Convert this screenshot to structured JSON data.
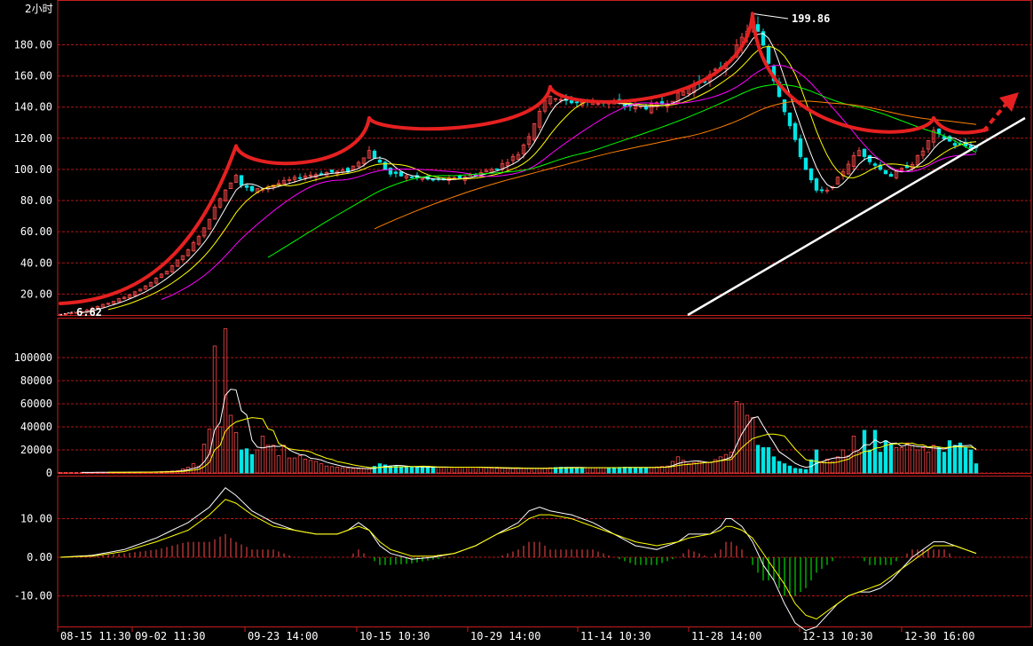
{
  "chart_data": {
    "type": "candlestick",
    "period_label": "2小时",
    "price_panel": {
      "ylim": [
        0,
        210
      ],
      "yticks": [
        "20.00",
        "40.00",
        "60.00",
        "80.00",
        "100.00",
        "120.00",
        "140.00",
        "160.00",
        "180.00"
      ],
      "high_label": "199.86",
      "low_label": "6.62",
      "ma_colors": [
        "#ffffff",
        "#ffff00",
        "#ff00ff",
        "#00ff00",
        "#ff8000"
      ],
      "anchors": [
        [
          0,
          7
        ],
        [
          4,
          9
        ],
        [
          8,
          13
        ],
        [
          12,
          18
        ],
        [
          16,
          25
        ],
        [
          20,
          35
        ],
        [
          24,
          48
        ],
        [
          27,
          62
        ],
        [
          30,
          82
        ],
        [
          33,
          97
        ],
        [
          34,
          90
        ],
        [
          36,
          86
        ],
        [
          38,
          88
        ],
        [
          42,
          92
        ],
        [
          46,
          96
        ],
        [
          50,
          98
        ],
        [
          54,
          99
        ],
        [
          56,
          105
        ],
        [
          58,
          112
        ],
        [
          60,
          104
        ],
        [
          62,
          97
        ],
        [
          66,
          95
        ],
        [
          70,
          93
        ],
        [
          74,
          94
        ],
        [
          78,
          97
        ],
        [
          82,
          101
        ],
        [
          86,
          110
        ],
        [
          88,
          122
        ],
        [
          90,
          138
        ],
        [
          92,
          148
        ],
        [
          94,
          144
        ],
        [
          98,
          143
        ],
        [
          102,
          143
        ],
        [
          106,
          141
        ],
        [
          110,
          140
        ],
        [
          114,
          143
        ],
        [
          118,
          152
        ],
        [
          122,
          160
        ],
        [
          126,
          172
        ],
        [
          128,
          184
        ],
        [
          130,
          195
        ],
        [
          132,
          180
        ],
        [
          134,
          158
        ],
        [
          136,
          138
        ],
        [
          138,
          118
        ],
        [
          140,
          100
        ],
        [
          142,
          86
        ],
        [
          144,
          86
        ],
        [
          146,
          94
        ],
        [
          148,
          104
        ],
        [
          150,
          112
        ],
        [
          152,
          106
        ],
        [
          154,
          100
        ],
        [
          156,
          96
        ],
        [
          158,
          100
        ],
        [
          160,
          104
        ],
        [
          162,
          112
        ],
        [
          164,
          124
        ],
        [
          166,
          120
        ],
        [
          168,
          116
        ],
        [
          170,
          115
        ],
        [
          172,
          114
        ]
      ],
      "candle_count": 173,
      "ma_periods": [
        5,
        10,
        20,
        40,
        60
      ]
    },
    "volume_panel": {
      "ylim": [
        0,
        115000
      ],
      "yticks": [
        "0",
        "20000",
        "40000",
        "60000",
        "80000",
        "100000"
      ],
      "bars": [
        [
          0,
          500
        ],
        [
          6,
          500
        ],
        [
          12,
          700
        ],
        [
          18,
          900
        ],
        [
          22,
          2000
        ],
        [
          24,
          5000
        ],
        [
          25,
          8000
        ],
        [
          26,
          6000
        ],
        [
          27,
          25000
        ],
        [
          28,
          38000
        ],
        [
          29,
          110000
        ],
        [
          30,
          40000
        ],
        [
          31,
          125000
        ],
        [
          32,
          50000
        ],
        [
          33,
          35000
        ],
        [
          34,
          20000
        ],
        [
          35,
          21000
        ],
        [
          36,
          16000
        ],
        [
          37,
          20000
        ],
        [
          38,
          32000
        ],
        [
          39,
          24000
        ],
        [
          40,
          24000
        ],
        [
          41,
          15000
        ],
        [
          42,
          24000
        ],
        [
          43,
          13000
        ],
        [
          44,
          13000
        ],
        [
          45,
          15000
        ],
        [
          46,
          12000
        ],
        [
          47,
          11000
        ],
        [
          48,
          10000
        ],
        [
          50,
          6000
        ],
        [
          54,
          4000
        ],
        [
          58,
          3500
        ],
        [
          60,
          8000
        ],
        [
          62,
          6000
        ],
        [
          66,
          5000
        ],
        [
          70,
          5000
        ],
        [
          74,
          5000
        ],
        [
          78,
          5000
        ],
        [
          82,
          4000
        ],
        [
          86,
          4000
        ],
        [
          90,
          4000
        ],
        [
          94,
          5000
        ],
        [
          98,
          4500
        ],
        [
          102,
          4500
        ],
        [
          106,
          5000
        ],
        [
          110,
          4500
        ],
        [
          114,
          6000
        ],
        [
          116,
          14000
        ],
        [
          118,
          8000
        ],
        [
          120,
          10000
        ],
        [
          122,
          9000
        ],
        [
          124,
          14000
        ],
        [
          126,
          18000
        ],
        [
          127,
          62000
        ],
        [
          128,
          60000
        ],
        [
          129,
          50000
        ],
        [
          130,
          48000
        ],
        [
          131,
          24000
        ],
        [
          132,
          22000
        ],
        [
          133,
          22000
        ],
        [
          134,
          14000
        ],
        [
          135,
          10000
        ],
        [
          136,
          8000
        ],
        [
          137,
          6000
        ],
        [
          138,
          4000
        ],
        [
          140,
          3000
        ],
        [
          142,
          20000
        ],
        [
          143,
          10000
        ],
        [
          144,
          12000
        ],
        [
          145,
          10000
        ],
        [
          146,
          14000
        ],
        [
          147,
          20000
        ],
        [
          148,
          15000
        ],
        [
          149,
          32000
        ],
        [
          150,
          18000
        ],
        [
          151,
          37000
        ],
        [
          152,
          20000
        ],
        [
          153,
          37000
        ],
        [
          154,
          18000
        ],
        [
          155,
          28000
        ],
        [
          156,
          25000
        ],
        [
          157,
          22000
        ],
        [
          158,
          22000
        ],
        [
          159,
          26000
        ],
        [
          160,
          24000
        ],
        [
          161,
          20000
        ],
        [
          162,
          22000
        ],
        [
          163,
          18000
        ],
        [
          164,
          24000
        ],
        [
          165,
          22000
        ],
        [
          166,
          18000
        ],
        [
          167,
          28000
        ],
        [
          168,
          24000
        ],
        [
          169,
          26000
        ],
        [
          170,
          22000
        ],
        [
          171,
          20000
        ],
        [
          172,
          8000
        ]
      ]
    },
    "macd_panel": {
      "ylim": [
        -22,
        22
      ],
      "yticks": [
        "10.00",
        "0.00",
        "-10.00"
      ],
      "dif": [
        [
          0,
          0
        ],
        [
          6,
          0.5
        ],
        [
          12,
          2
        ],
        [
          18,
          5
        ],
        [
          24,
          9
        ],
        [
          28,
          13
        ],
        [
          31,
          18
        ],
        [
          33,
          16
        ],
        [
          36,
          12
        ],
        [
          40,
          9
        ],
        [
          44,
          7
        ],
        [
          48,
          6
        ],
        [
          52,
          6
        ],
        [
          54,
          7
        ],
        [
          56,
          9
        ],
        [
          58,
          7
        ],
        [
          60,
          3
        ],
        [
          62,
          1
        ],
        [
          66,
          -0.5
        ],
        [
          70,
          0
        ],
        [
          74,
          1
        ],
        [
          78,
          3
        ],
        [
          82,
          6
        ],
        [
          86,
          9
        ],
        [
          88,
          12
        ],
        [
          90,
          13
        ],
        [
          92,
          12
        ],
        [
          96,
          11
        ],
        [
          100,
          9
        ],
        [
          104,
          6
        ],
        [
          108,
          3
        ],
        [
          112,
          2
        ],
        [
          116,
          4
        ],
        [
          118,
          6
        ],
        [
          122,
          6
        ],
        [
          124,
          8
        ],
        [
          125,
          10
        ],
        [
          126,
          10
        ],
        [
          128,
          8
        ],
        [
          130,
          4
        ],
        [
          132,
          -2
        ],
        [
          134,
          -6
        ],
        [
          136,
          -12
        ],
        [
          138,
          -17
        ],
        [
          140,
          -19
        ],
        [
          142,
          -18
        ],
        [
          144,
          -15
        ],
        [
          146,
          -12
        ],
        [
          148,
          -10
        ],
        [
          150,
          -9
        ],
        [
          152,
          -9
        ],
        [
          154,
          -8
        ],
        [
          156,
          -6
        ],
        [
          158,
          -3
        ],
        [
          160,
          0
        ],
        [
          162,
          2
        ],
        [
          164,
          4
        ],
        [
          166,
          4
        ],
        [
          168,
          3
        ],
        [
          170,
          2
        ],
        [
          172,
          1
        ]
      ],
      "dea": [
        [
          0,
          0
        ],
        [
          6,
          0.3
        ],
        [
          12,
          1.5
        ],
        [
          18,
          4
        ],
        [
          24,
          7
        ],
        [
          28,
          11
        ],
        [
          31,
          15
        ],
        [
          33,
          14
        ],
        [
          36,
          11
        ],
        [
          40,
          8
        ],
        [
          44,
          7
        ],
        [
          48,
          6
        ],
        [
          52,
          6
        ],
        [
          54,
          7
        ],
        [
          56,
          8
        ],
        [
          58,
          7
        ],
        [
          60,
          4
        ],
        [
          62,
          2
        ],
        [
          66,
          0.3
        ],
        [
          70,
          0.3
        ],
        [
          74,
          1
        ],
        [
          78,
          3
        ],
        [
          82,
          6
        ],
        [
          86,
          8
        ],
        [
          88,
          10
        ],
        [
          90,
          11
        ],
        [
          92,
          11
        ],
        [
          96,
          10
        ],
        [
          100,
          8
        ],
        [
          104,
          6
        ],
        [
          108,
          4
        ],
        [
          112,
          3
        ],
        [
          116,
          4
        ],
        [
          118,
          5
        ],
        [
          122,
          6
        ],
        [
          124,
          7
        ],
        [
          125,
          8
        ],
        [
          126,
          8
        ],
        [
          128,
          7
        ],
        [
          130,
          5
        ],
        [
          132,
          1
        ],
        [
          134,
          -3
        ],
        [
          136,
          -7
        ],
        [
          138,
          -12
        ],
        [
          140,
          -15
        ],
        [
          142,
          -16
        ],
        [
          144,
          -14
        ],
        [
          146,
          -12
        ],
        [
          148,
          -10
        ],
        [
          150,
          -9
        ],
        [
          152,
          -8
        ],
        [
          154,
          -7
        ],
        [
          156,
          -5
        ],
        [
          158,
          -3
        ],
        [
          160,
          -1
        ],
        [
          162,
          1
        ],
        [
          164,
          3
        ],
        [
          166,
          3
        ],
        [
          168,
          3
        ],
        [
          170,
          2
        ],
        [
          172,
          1
        ]
      ]
    },
    "x_ticks": [
      "08-15 11:30",
      "09-02 11:30",
      "09-23 14:00",
      "10-15 10:30",
      "10-29 14:00",
      "11-14 10:30",
      "11-28 14:00",
      "12-13 10:30",
      "12-30 16:00"
    ],
    "annotation_colors": {
      "resistance_arcs": "#e62020",
      "support_line": "#ffffff",
      "arrow": "#e62020"
    },
    "panel_colors": {
      "border": "#c81e1e",
      "grid": "#b41414",
      "up": "#ff4a4a",
      "down": "#00e5e5"
    }
  }
}
